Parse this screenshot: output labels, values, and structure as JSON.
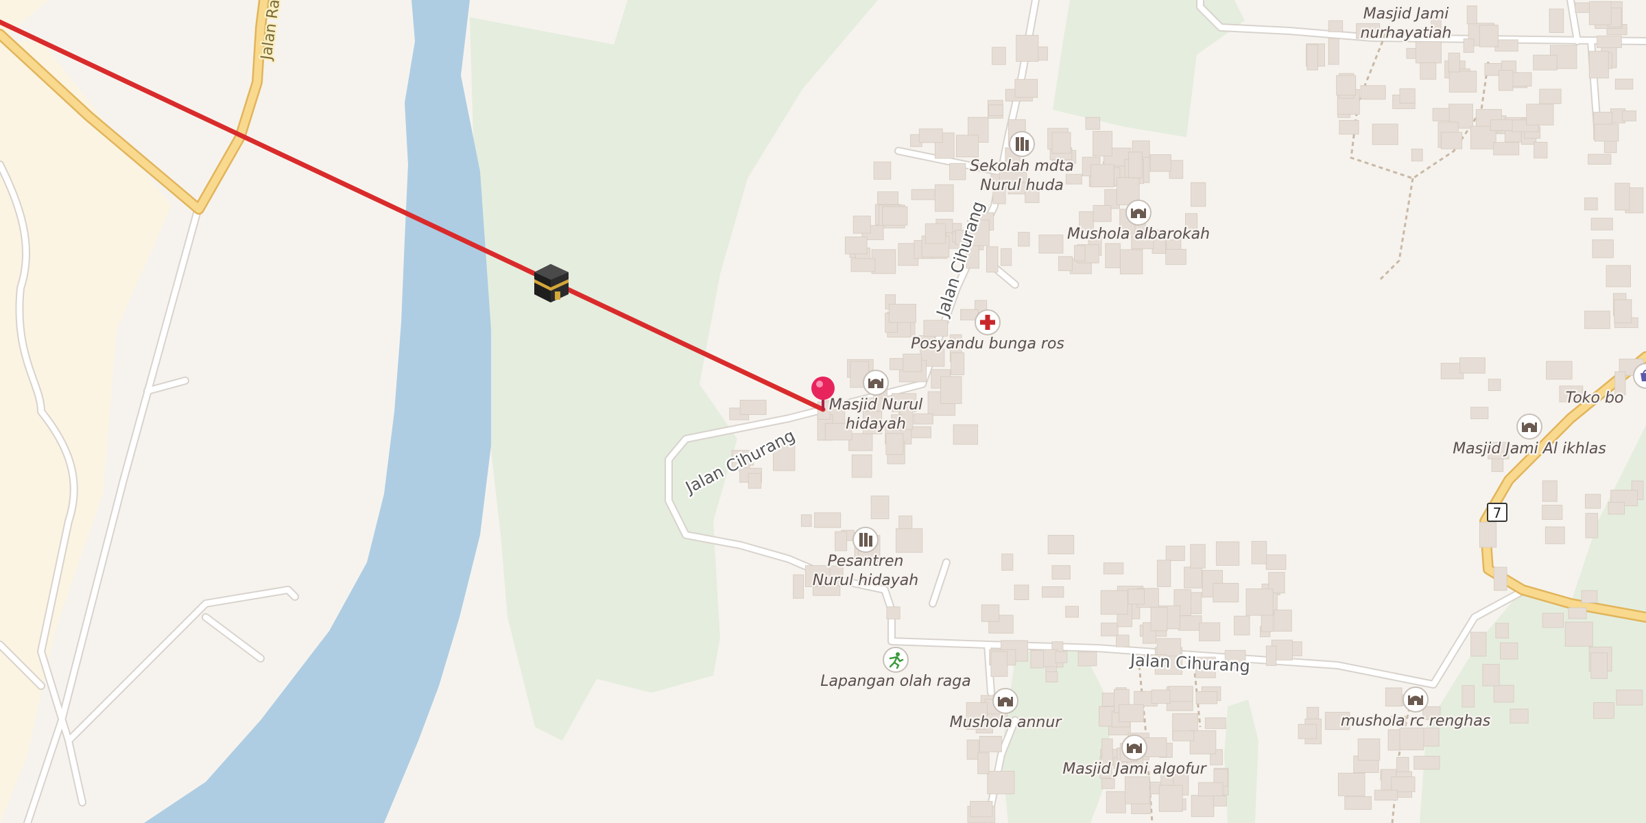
{
  "map": {
    "colors": {
      "land": "#f6f3ee",
      "water": "#aecde3",
      "park": "#e5edde",
      "residential": "#fbf4e2",
      "building": "#e6ded6",
      "road": "#ffffff",
      "road_casing": "#d8d2cc",
      "highway": "#f8d98e",
      "highway_casing": "#e2b45a",
      "qibla_line": "#d92b2b",
      "pin": "#e8245d"
    },
    "qibla_marker": {
      "icon": "kaaba-icon"
    },
    "location_pin": {
      "icon": "map-pin-icon"
    },
    "route_shield": {
      "text": "7"
    },
    "road_labels": [
      {
        "id": "jalan-cihurang-1",
        "text": "Jalan Cihurang"
      },
      {
        "id": "jalan-cihurang-2",
        "text": "Jalan Cihurang"
      },
      {
        "id": "jalan-cihurang-3",
        "text": "Jalan Cihurang"
      },
      {
        "id": "jalan-ra",
        "text": "Jalan Ra"
      }
    ],
    "pois": [
      {
        "id": "masjid-jami-nurhayatiah",
        "icon": "mosque-icon",
        "lines": [
          "Masjid Jami",
          "nurhayatiah"
        ]
      },
      {
        "id": "sekolah-mdta-nurul-huda",
        "icon": "school-icon",
        "lines": [
          "Sekolah mdta",
          "Nurul huda"
        ]
      },
      {
        "id": "mushola-albarokah",
        "icon": "mosque-icon",
        "lines": [
          "Mushola albarokah"
        ]
      },
      {
        "id": "posyandu-bunga-ros",
        "icon": "health-cross-icon",
        "lines": [
          "Posyandu bunga ros"
        ]
      },
      {
        "id": "masjid-nurul-hidayah",
        "icon": "mosque-icon",
        "lines": [
          "Masjid Nurul",
          "hidayah"
        ]
      },
      {
        "id": "masjid-jami-al-ikhlas",
        "icon": "mosque-icon",
        "lines": [
          "Masjid Jami Al ikhlas"
        ]
      },
      {
        "id": "toko-bo",
        "icon": "shop-icon",
        "lines": [
          "Toko bo"
        ]
      },
      {
        "id": "pesantren-nurul-hidayah",
        "icon": "school-icon",
        "lines": [
          "Pesantren",
          "Nurul hidayah"
        ]
      },
      {
        "id": "lapangan-olah-raga",
        "icon": "sports-icon",
        "lines": [
          "Lapangan olah raga"
        ]
      },
      {
        "id": "mushola-annur",
        "icon": "mosque-icon",
        "lines": [
          "Mushola annur"
        ]
      },
      {
        "id": "masjid-jami-algofur",
        "icon": "mosque-icon",
        "lines": [
          "Masjid Jami algofur"
        ]
      },
      {
        "id": "mushola-rc-renghas",
        "icon": "mosque-icon",
        "lines": [
          "mushola rc renghas"
        ]
      }
    ]
  }
}
